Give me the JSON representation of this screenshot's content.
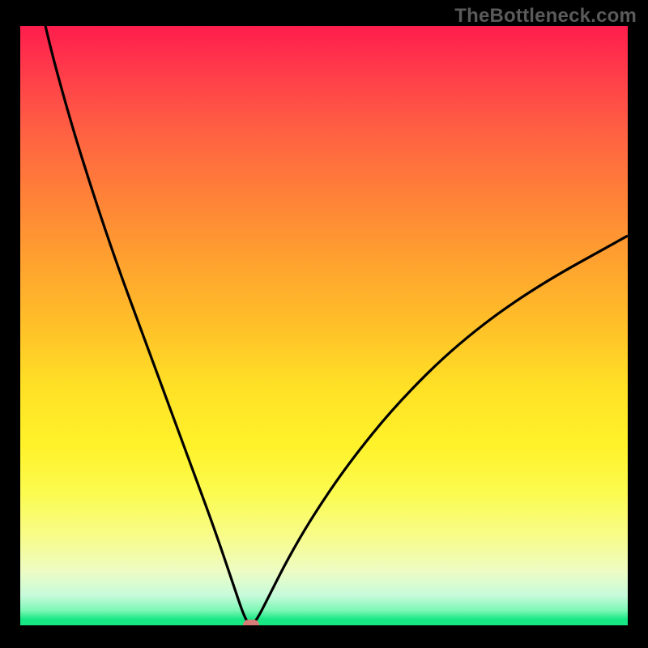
{
  "watermark": "TheBottleneck.com",
  "colors": {
    "frame": "#000000",
    "curve": "#000000",
    "marker": "#d67d78",
    "gradient_top": "#ff1d4d",
    "gradient_bottom": "#18e884"
  },
  "chart_data": {
    "type": "line",
    "title": "",
    "xlabel": "",
    "ylabel": "",
    "xlim": [
      0,
      100
    ],
    "ylim": [
      0,
      100
    ],
    "grid": false,
    "legend": false,
    "notes": "V-shaped bottleneck curve; y ~ 0 at x ~ 38 (optimal), rising steeply on both sides. Background gradient maps value: top = high (red), bottom = low (green).",
    "series": [
      {
        "name": "bottleneck-curve",
        "x": [
          0,
          4,
          8,
          12,
          16,
          20,
          24,
          28,
          32,
          35,
          37,
          38,
          39,
          41,
          44,
          48,
          54,
          62,
          72,
          84,
          100
        ],
        "y": [
          120,
          100,
          85,
          72,
          60,
          49,
          38,
          27,
          16,
          7,
          1,
          0,
          1,
          5,
          11,
          18,
          27,
          37,
          47,
          56,
          65
        ]
      }
    ],
    "marker": {
      "x": 38,
      "y": 0,
      "label": "optimal-point"
    }
  }
}
